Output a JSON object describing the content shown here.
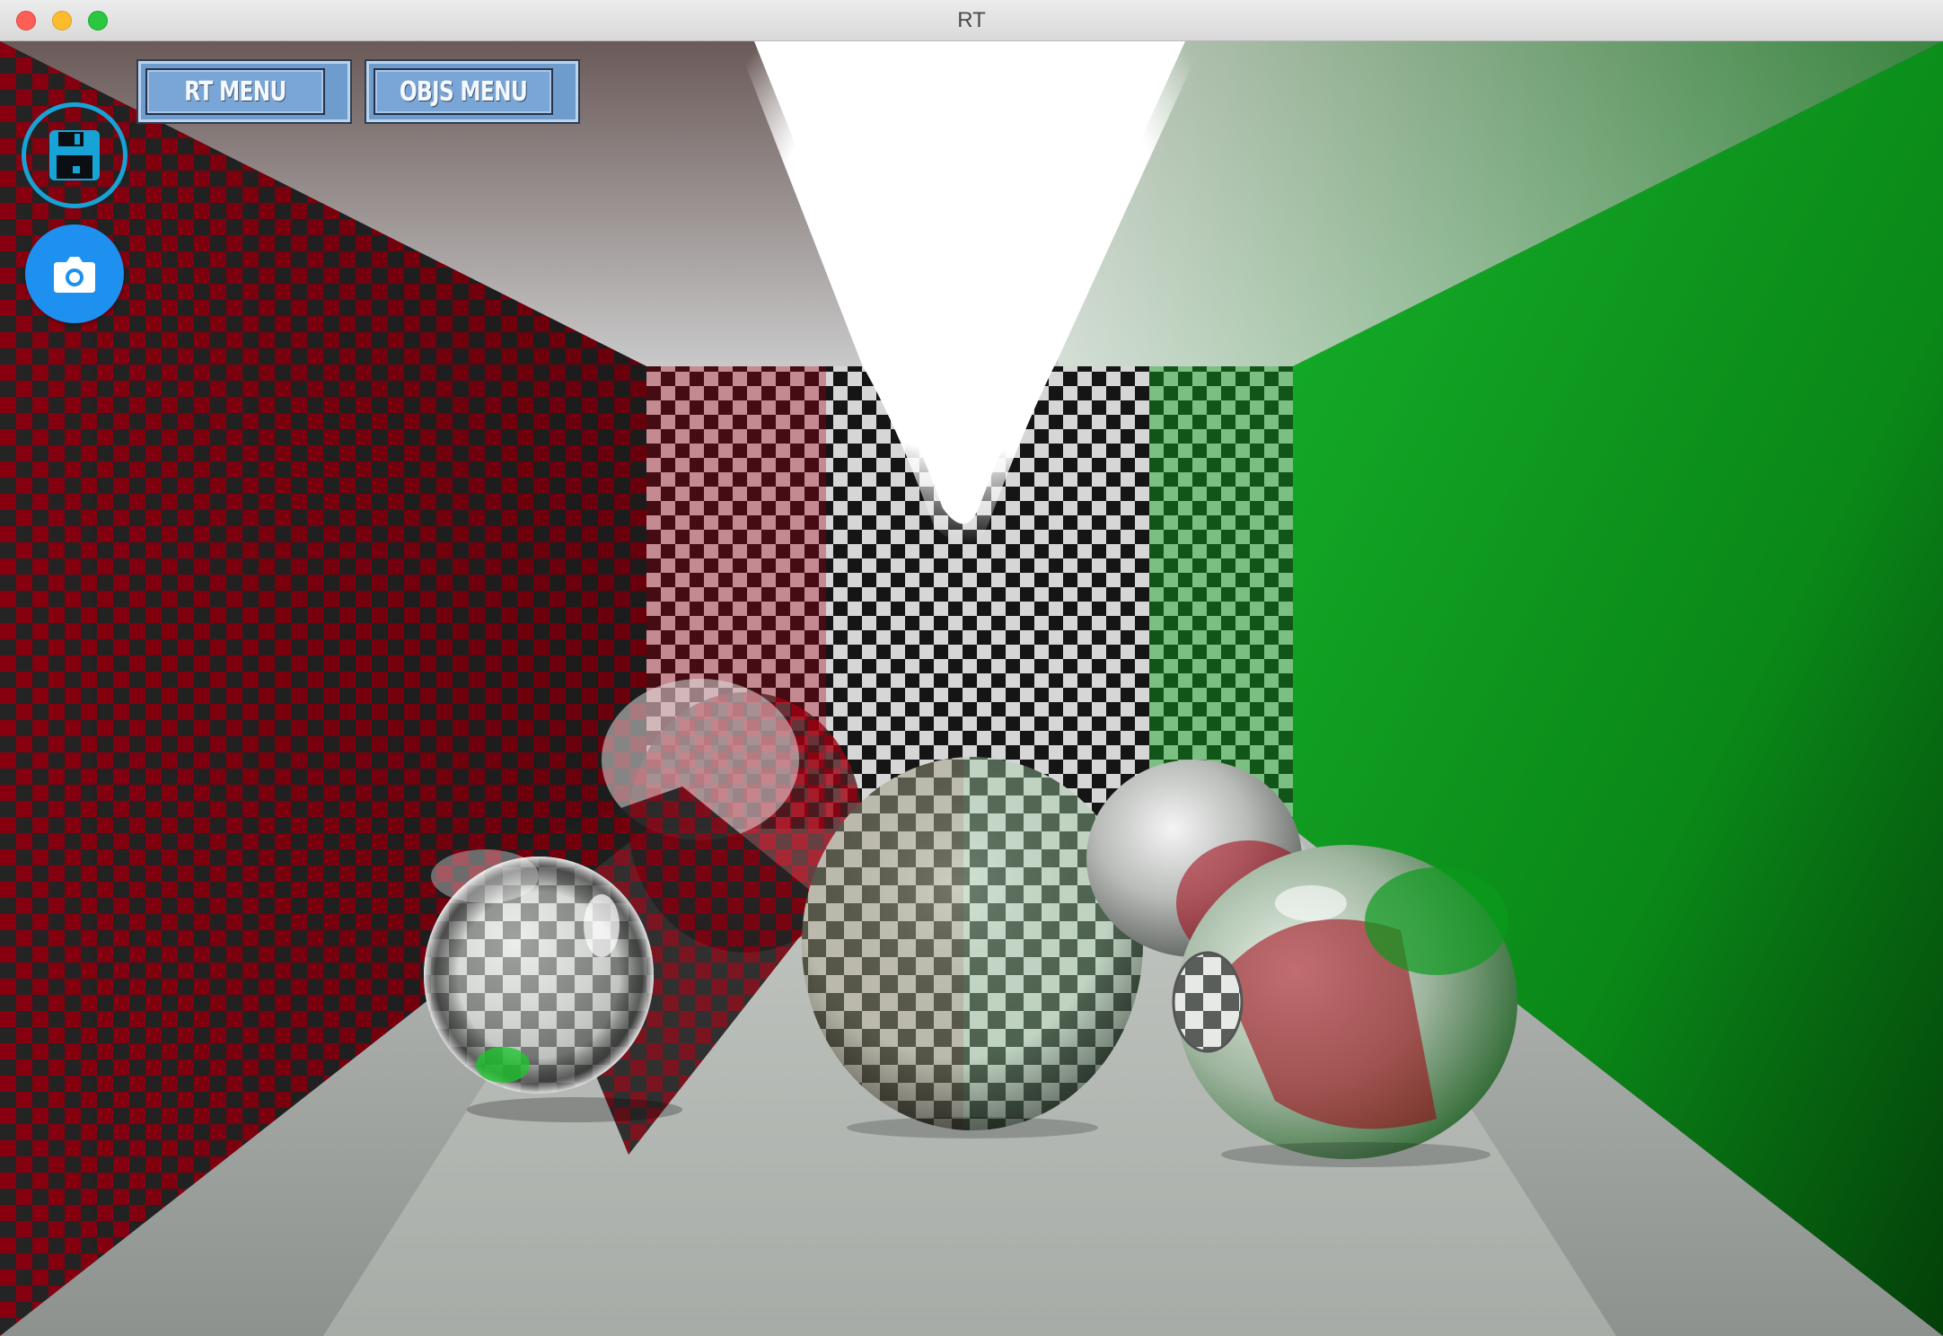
{
  "window": {
    "title": "RT"
  },
  "toolbar": {
    "save_icon": "floppy-disk-save-icon",
    "camera_icon": "camera-screenshot-icon",
    "rt_menu_label": "RT MENU",
    "objs_menu_label": "OBJS MENU"
  },
  "colors": {
    "button_fill": "#6e9ccd",
    "save_ring": "#17a3d6",
    "camera_button": "#1e90f0",
    "left_wall_red": "#a00010",
    "right_wall_green": "#0a9a1a",
    "light": "#ffffff"
  }
}
